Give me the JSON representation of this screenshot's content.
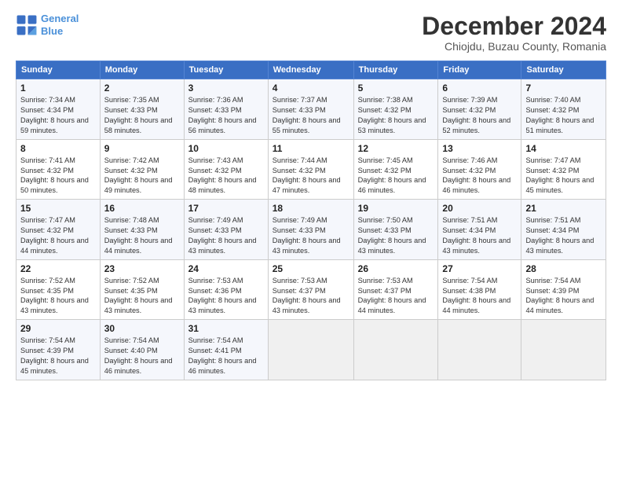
{
  "header": {
    "logo_line1": "General",
    "logo_line2": "Blue",
    "month_title": "December 2024",
    "subtitle": "Chiojdu, Buzau County, Romania"
  },
  "weekdays": [
    "Sunday",
    "Monday",
    "Tuesday",
    "Wednesday",
    "Thursday",
    "Friday",
    "Saturday"
  ],
  "weeks": [
    [
      {
        "day": "1",
        "sunrise": "7:34 AM",
        "sunset": "4:34 PM",
        "daylight": "8 hours and 59 minutes."
      },
      {
        "day": "2",
        "sunrise": "7:35 AM",
        "sunset": "4:33 PM",
        "daylight": "8 hours and 58 minutes."
      },
      {
        "day": "3",
        "sunrise": "7:36 AM",
        "sunset": "4:33 PM",
        "daylight": "8 hours and 56 minutes."
      },
      {
        "day": "4",
        "sunrise": "7:37 AM",
        "sunset": "4:33 PM",
        "daylight": "8 hours and 55 minutes."
      },
      {
        "day": "5",
        "sunrise": "7:38 AM",
        "sunset": "4:32 PM",
        "daylight": "8 hours and 53 minutes."
      },
      {
        "day": "6",
        "sunrise": "7:39 AM",
        "sunset": "4:32 PM",
        "daylight": "8 hours and 52 minutes."
      },
      {
        "day": "7",
        "sunrise": "7:40 AM",
        "sunset": "4:32 PM",
        "daylight": "8 hours and 51 minutes."
      }
    ],
    [
      {
        "day": "8",
        "sunrise": "7:41 AM",
        "sunset": "4:32 PM",
        "daylight": "8 hours and 50 minutes."
      },
      {
        "day": "9",
        "sunrise": "7:42 AM",
        "sunset": "4:32 PM",
        "daylight": "8 hours and 49 minutes."
      },
      {
        "day": "10",
        "sunrise": "7:43 AM",
        "sunset": "4:32 PM",
        "daylight": "8 hours and 48 minutes."
      },
      {
        "day": "11",
        "sunrise": "7:44 AM",
        "sunset": "4:32 PM",
        "daylight": "8 hours and 47 minutes."
      },
      {
        "day": "12",
        "sunrise": "7:45 AM",
        "sunset": "4:32 PM",
        "daylight": "8 hours and 46 minutes."
      },
      {
        "day": "13",
        "sunrise": "7:46 AM",
        "sunset": "4:32 PM",
        "daylight": "8 hours and 46 minutes."
      },
      {
        "day": "14",
        "sunrise": "7:47 AM",
        "sunset": "4:32 PM",
        "daylight": "8 hours and 45 minutes."
      }
    ],
    [
      {
        "day": "15",
        "sunrise": "7:47 AM",
        "sunset": "4:32 PM",
        "daylight": "8 hours and 44 minutes."
      },
      {
        "day": "16",
        "sunrise": "7:48 AM",
        "sunset": "4:33 PM",
        "daylight": "8 hours and 44 minutes."
      },
      {
        "day": "17",
        "sunrise": "7:49 AM",
        "sunset": "4:33 PM",
        "daylight": "8 hours and 43 minutes."
      },
      {
        "day": "18",
        "sunrise": "7:49 AM",
        "sunset": "4:33 PM",
        "daylight": "8 hours and 43 minutes."
      },
      {
        "day": "19",
        "sunrise": "7:50 AM",
        "sunset": "4:33 PM",
        "daylight": "8 hours and 43 minutes."
      },
      {
        "day": "20",
        "sunrise": "7:51 AM",
        "sunset": "4:34 PM",
        "daylight": "8 hours and 43 minutes."
      },
      {
        "day": "21",
        "sunrise": "7:51 AM",
        "sunset": "4:34 PM",
        "daylight": "8 hours and 43 minutes."
      }
    ],
    [
      {
        "day": "22",
        "sunrise": "7:52 AM",
        "sunset": "4:35 PM",
        "daylight": "8 hours and 43 minutes."
      },
      {
        "day": "23",
        "sunrise": "7:52 AM",
        "sunset": "4:35 PM",
        "daylight": "8 hours and 43 minutes."
      },
      {
        "day": "24",
        "sunrise": "7:53 AM",
        "sunset": "4:36 PM",
        "daylight": "8 hours and 43 minutes."
      },
      {
        "day": "25",
        "sunrise": "7:53 AM",
        "sunset": "4:37 PM",
        "daylight": "8 hours and 43 minutes."
      },
      {
        "day": "26",
        "sunrise": "7:53 AM",
        "sunset": "4:37 PM",
        "daylight": "8 hours and 44 minutes."
      },
      {
        "day": "27",
        "sunrise": "7:54 AM",
        "sunset": "4:38 PM",
        "daylight": "8 hours and 44 minutes."
      },
      {
        "day": "28",
        "sunrise": "7:54 AM",
        "sunset": "4:39 PM",
        "daylight": "8 hours and 44 minutes."
      }
    ],
    [
      {
        "day": "29",
        "sunrise": "7:54 AM",
        "sunset": "4:39 PM",
        "daylight": "8 hours and 45 minutes."
      },
      {
        "day": "30",
        "sunrise": "7:54 AM",
        "sunset": "4:40 PM",
        "daylight": "8 hours and 46 minutes."
      },
      {
        "day": "31",
        "sunrise": "7:54 AM",
        "sunset": "4:41 PM",
        "daylight": "8 hours and 46 minutes."
      },
      null,
      null,
      null,
      null
    ]
  ]
}
